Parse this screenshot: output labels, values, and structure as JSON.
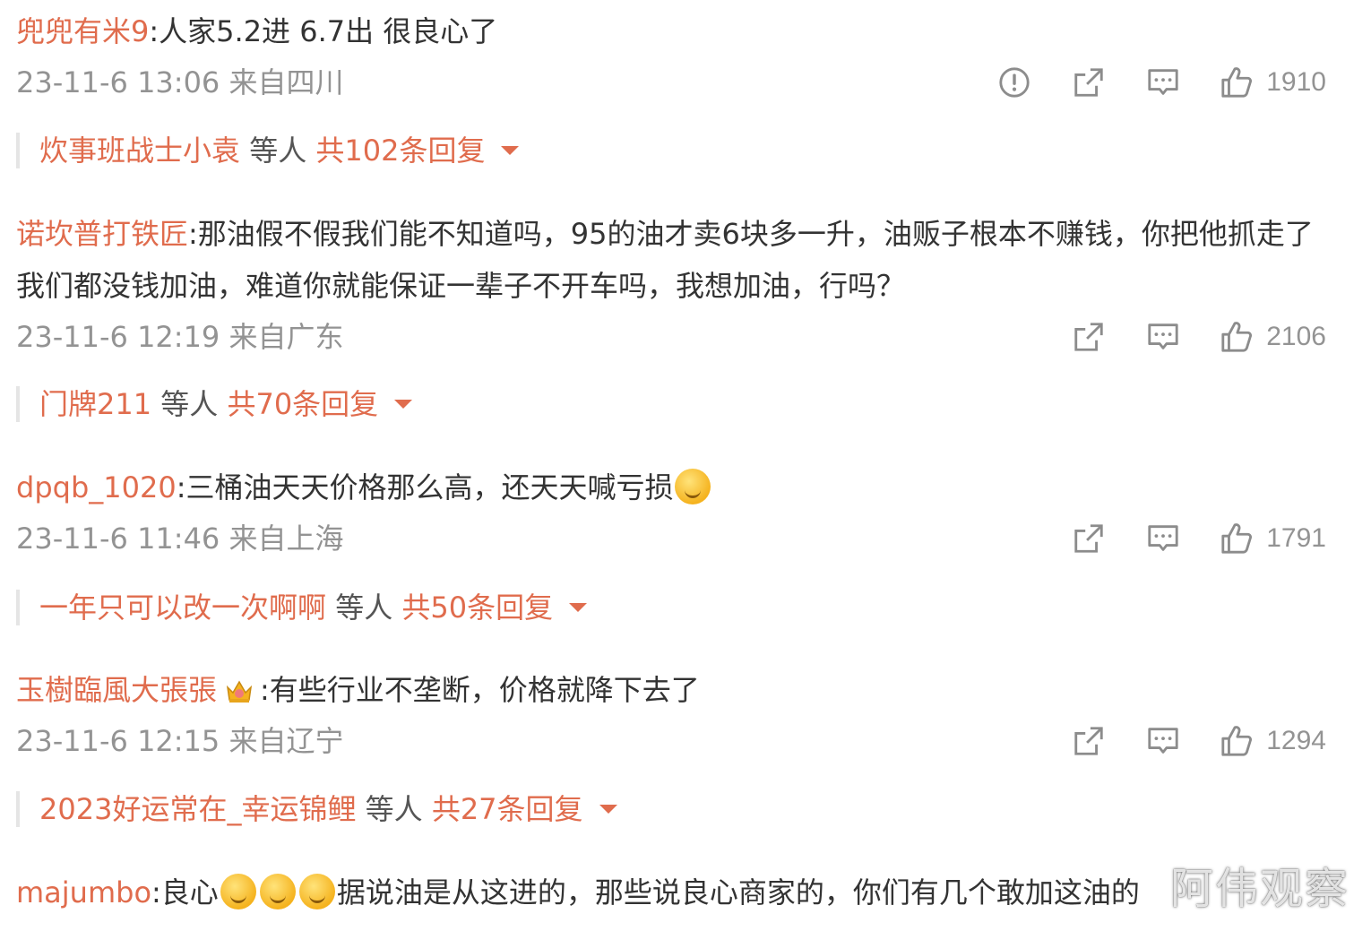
{
  "comments": [
    {
      "author": "兜兜有米9",
      "text": ":人家5.2进  6.7出  很良心了",
      "timestamp": "23-11-6 13:06 来自四川",
      "likes": "1910",
      "replies": {
        "names": "炊事班战士小袁",
        "mid": " 等人 ",
        "count": "共102条回复"
      }
    },
    {
      "author": "诺坎普打铁匠",
      "text": ":那油假不假我们能不知道吗，95的油才卖6块多一升，油贩子根本不赚钱，你把他抓走了我们都没钱加油，难道你就能保证一辈子不开车吗，我想加油，行吗？",
      "timestamp": "23-11-6 12:19 来自广东",
      "likes": "2106",
      "replies": {
        "names": "门牌211",
        "mid": " 等人 ",
        "count": "共70条回复"
      }
    },
    {
      "author": "dpqb_1020",
      "text": ":三桶油天天价格那么高，还天天喊亏损",
      "timestamp": "23-11-6 11:46 来自上海",
      "likes": "1791",
      "replies": {
        "names": "一年只可以改一次啊啊",
        "mid": " 等人 ",
        "count": "共50条回复"
      }
    },
    {
      "author": "玉樹臨風大張張",
      "text": ":有些行业不垄断，价格就降下去了",
      "timestamp": "23-11-6 12:15 来自辽宁",
      "likes": "1294",
      "replies": {
        "names": "2023好运常在_幸运锦鲤",
        "mid": " 等人 ",
        "count": "共27条回复"
      }
    },
    {
      "author": "majumbo",
      "text_a": ":良心",
      "text_b": "据说油是从这进的，那些说良心商家的，你们有几个敢加这油的"
    }
  ],
  "icons": {
    "report": "exclamation-circle-icon",
    "share": "share-out-icon",
    "comment": "comment-bubble-icon",
    "like": "thumbs-up-icon",
    "expand": "caret-down-icon",
    "emoji": "crying-laugh-emoji-icon",
    "badge": "crown-badge-icon"
  },
  "colors": {
    "accent": "#e06c4d",
    "text": "#333333",
    "meta": "#939393"
  },
  "watermark": "阿伟观察"
}
